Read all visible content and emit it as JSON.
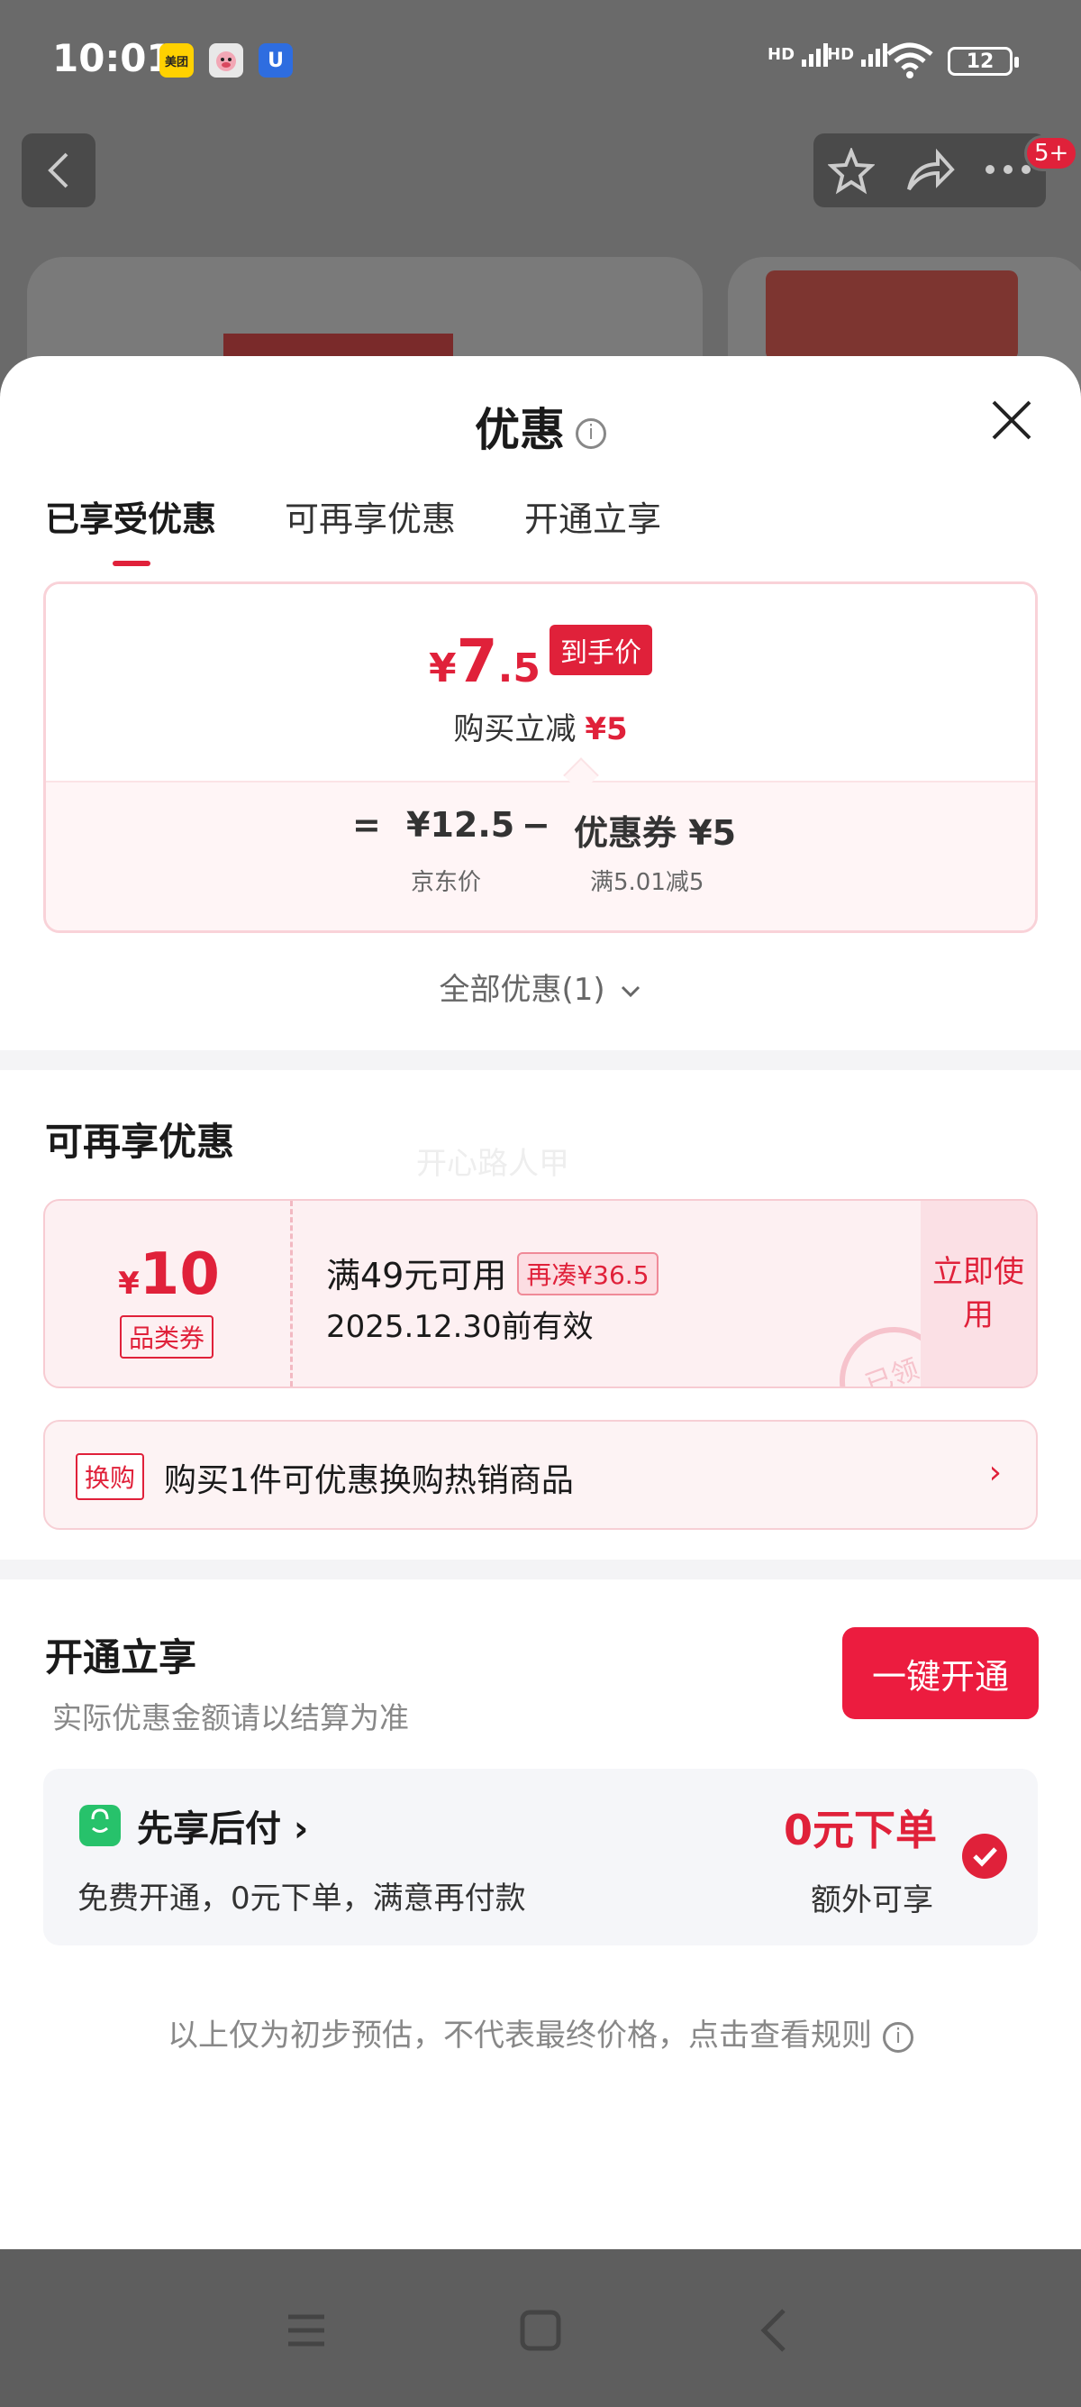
{
  "status_bar": {
    "time": "10:01",
    "apps": [
      "美团",
      "",
      "U"
    ],
    "signal1": "HD",
    "signal2": "HD",
    "battery": "12"
  },
  "background": {
    "cart_badge": "5+"
  },
  "sheet": {
    "title": "优惠",
    "tabs": [
      "已享受优惠",
      "可再享优惠",
      "开通立享"
    ],
    "price": {
      "symbol": "¥",
      "integer": "7",
      "decimal": ".5",
      "tag": "到手价",
      "discount_label": "购买立减",
      "discount_value": "¥5",
      "formula": {
        "equals": "=",
        "jd_price": "¥12.5",
        "minus": "−",
        "coupon": "优惠券 ¥5",
        "jd_price_label": "京东价",
        "coupon_label": "满5.01减5"
      }
    },
    "all_offers": "全部优惠(1)",
    "more_offers": {
      "title": "可再享优惠",
      "watermark": "开心路人甲",
      "coupon": {
        "symbol": "¥",
        "amount": "10",
        "type": "品类券",
        "condition": "满49元可用",
        "extra": "再凑¥36.5",
        "validity": "2025.12.30前有效",
        "use_button": "立即使用",
        "stamp": "已领"
      },
      "swap": {
        "tag": "换购",
        "text": "购买1件可优惠换购热销商品",
        "arrow": "›"
      }
    },
    "open_now": {
      "title": "开通立享",
      "subtitle": "实际优惠金额请以结算为准",
      "button": "一键开通",
      "paylater": {
        "title": "先享后付 ›",
        "desc": "免费开通，0元下单，满意再付款",
        "zero": "0元下单",
        "extra": "额外可享"
      }
    },
    "footnote": "以上仅为初步预估，不代表最终价格，点击查看规则"
  },
  "colors": {
    "accent": "#e0213a",
    "button": "#ec1c3f",
    "green": "#27c26b"
  }
}
